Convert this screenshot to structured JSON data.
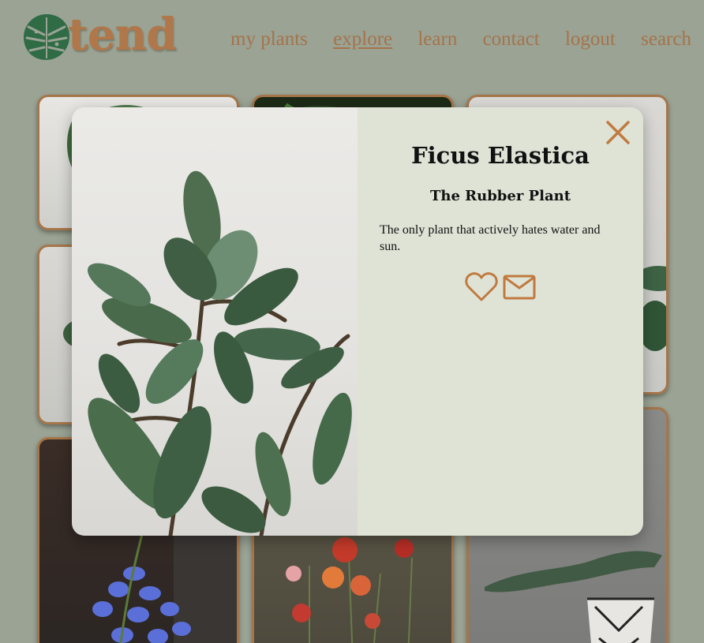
{
  "header": {
    "logo_text": "tend",
    "nav": [
      {
        "label": "my plants",
        "active": false
      },
      {
        "label": "explore",
        "active": true
      },
      {
        "label": "learn",
        "active": false
      },
      {
        "label": "contact",
        "active": false
      },
      {
        "label": "logout",
        "active": false
      },
      {
        "label": "search",
        "active": false
      }
    ]
  },
  "modal": {
    "plant_name": "Ficus Elastica",
    "common_name": "The Rubber Plant",
    "description": "The only plant that actively hates water and sun.",
    "icons": [
      "heart-icon",
      "mail-icon",
      "close-icon"
    ]
  },
  "colors": {
    "background": "#9aa394",
    "accent": "#c07a3f",
    "panel": "#dfe3d6",
    "logo_green": "#2f6b45"
  }
}
